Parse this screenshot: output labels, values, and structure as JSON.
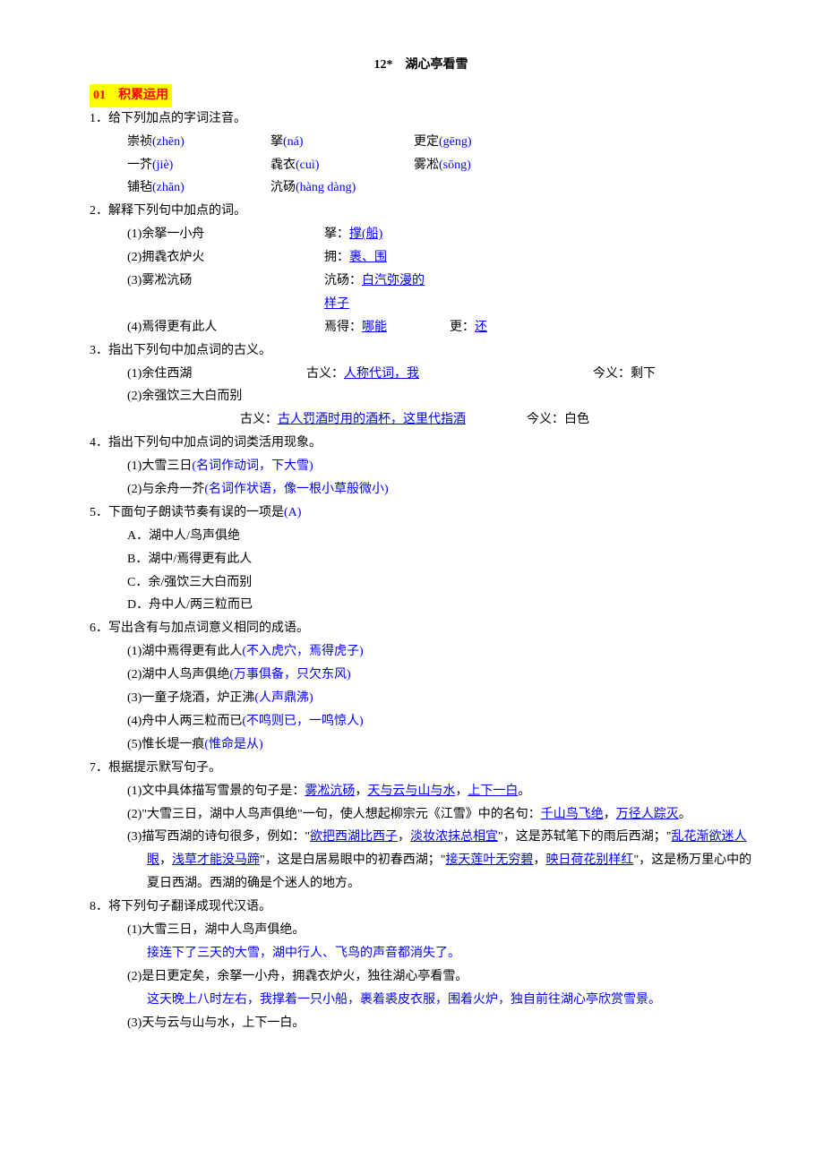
{
  "title": "12*　湖心亭看雪",
  "section1": "01　积累运用",
  "q1": {
    "stem": "1．给下列加点的字词注音。",
    "rows": [
      [
        "崇祯",
        "(zhēn)",
        "拏",
        "(ná)",
        "更定",
        "(gēng)"
      ],
      [
        "一芥",
        "(jiè)",
        "毳衣",
        "(cuì)",
        "雾凇",
        "(sōng)"
      ],
      [
        "铺毡",
        "(zhān)",
        "沆砀",
        "(hàng dàng)",
        "",
        ""
      ]
    ]
  },
  "q2": {
    "stem": "2．解释下列句中加点的词。",
    "items": [
      {
        "no": "(1)",
        "txt": "余拏一小舟",
        "label": "拏：",
        "ans": "撑(船)"
      },
      {
        "no": "(2)",
        "txt": "拥毳衣炉火",
        "label": "拥：",
        "ans": "裹、围"
      },
      {
        "no": "(3)",
        "txt": "雾凇沆砀",
        "label": "沆砀：",
        "ans": "白汽弥漫的样子"
      }
    ],
    "item4": {
      "no": "(4)",
      "txt": "焉得更有此人",
      "label1": "焉得：",
      "ans1": "哪能",
      "label2": "更：",
      "ans2": "还"
    }
  },
  "q3": {
    "stem": "3．指出下列句中加点词的古义。",
    "row1": {
      "no": "(1)",
      "txt": "余住西湖",
      "gu_label": "古义：",
      "gu": "人称代词，我",
      "jin_label": "今义：剩下"
    },
    "row2": {
      "no": "(2)",
      "txt": "余强饮三大白而别"
    },
    "row2b": {
      "gu_label": "古义：",
      "gu": "古人罚酒时用的酒杯，这里代指酒",
      "jin_label": "今义：白色"
    }
  },
  "q4": {
    "stem": "4．指出下列句中加点词的词类活用现象。",
    "items": [
      {
        "no": "(1)",
        "txt": "大雪三日",
        "ans": "(名词作动词，下大雪)"
      },
      {
        "no": "(2)",
        "txt": "与余舟一芥",
        "ans": "(名词作状语，像一根小草般微小)"
      }
    ]
  },
  "q5": {
    "stem_pre": "5．下面句子朗读节奏有误的一项是",
    "ans": "(A)",
    "opts": [
      "A．湖中人/鸟声俱绝",
      "B．湖中/焉得更有此人",
      "C．余/强饮三大白而别",
      "D．舟中人/两三粒而已"
    ]
  },
  "q6": {
    "stem": "6．写出含有与加点词意义相同的成语。",
    "items": [
      {
        "no": "(1)",
        "txt": "湖中焉得更有此人",
        "ans": "(不入虎穴，焉得虎子)"
      },
      {
        "no": "(2)",
        "txt": "湖中人鸟声俱绝",
        "ans": "(万事俱备，只欠东风)"
      },
      {
        "no": "(3)",
        "txt": "一童子烧酒，炉正沸",
        "ans": "(人声鼎沸)"
      },
      {
        "no": "(4)",
        "txt": "舟中人两三粒而已",
        "ans": "(不鸣则已，一鸣惊人)"
      },
      {
        "no": "(5)",
        "txt": "惟长堤一痕",
        "ans": "(惟命是从)"
      }
    ]
  },
  "q7": {
    "stem": "7．根据提示默写句子。",
    "i1": {
      "pre": "(1)文中具体描写雪景的句子是：",
      "a": "雾凇沆砀",
      "c1": "，",
      "b": "天与云与山与水",
      "c2": "，",
      "c": "上下一白",
      "suf": "。"
    },
    "i2": {
      "pre": "(2)\"大雪三日，湖中人鸟声俱绝\"一句，使人想起柳宗元《江雪》中的名句：",
      "a": "千山鸟飞绝",
      "c1": "，",
      "b": "万径人踪灭",
      "suf": "。"
    },
    "i3": {
      "pre": "(3)描写西湖的诗句很多，例如：\"",
      "a": "欲把西湖比西子",
      "c1": "，",
      "b": "淡妆浓抹总相宜",
      "mid1": "\"，这是苏轼笔下的雨后西湖；\"",
      "c": "乱花渐欲迷人眼",
      "c2": "，",
      "d": "浅草才能没马蹄",
      "mid2": "\"，这是白居易眼中的初春西湖；\"",
      "e": "接天莲叶无穷碧",
      "c3": "，",
      "f": "映日荷花别样红",
      "suf": "\"，这是杨万里心中的夏日西湖。西湖的确是个迷人的地方。"
    }
  },
  "q8": {
    "stem": "8．将下列句子翻译成现代汉语。",
    "items": [
      {
        "no": "(1)",
        "q": "大雪三日，湖中人鸟声俱绝。",
        "a": "接连下了三天的大雪，湖中行人、飞鸟的声音都消失了。"
      },
      {
        "no": "(2)",
        "q": "是日更定矣，余拏一小舟，拥毳衣炉火，独往湖心亭看雪。",
        "a": "这天晚上八时左右，我撑着一只小船，裹着裘皮衣服，围着火炉，独自前往湖心亭欣赏雪景。"
      },
      {
        "no": "(3)",
        "q": "天与云与山与水，上下一白。"
      }
    ]
  }
}
